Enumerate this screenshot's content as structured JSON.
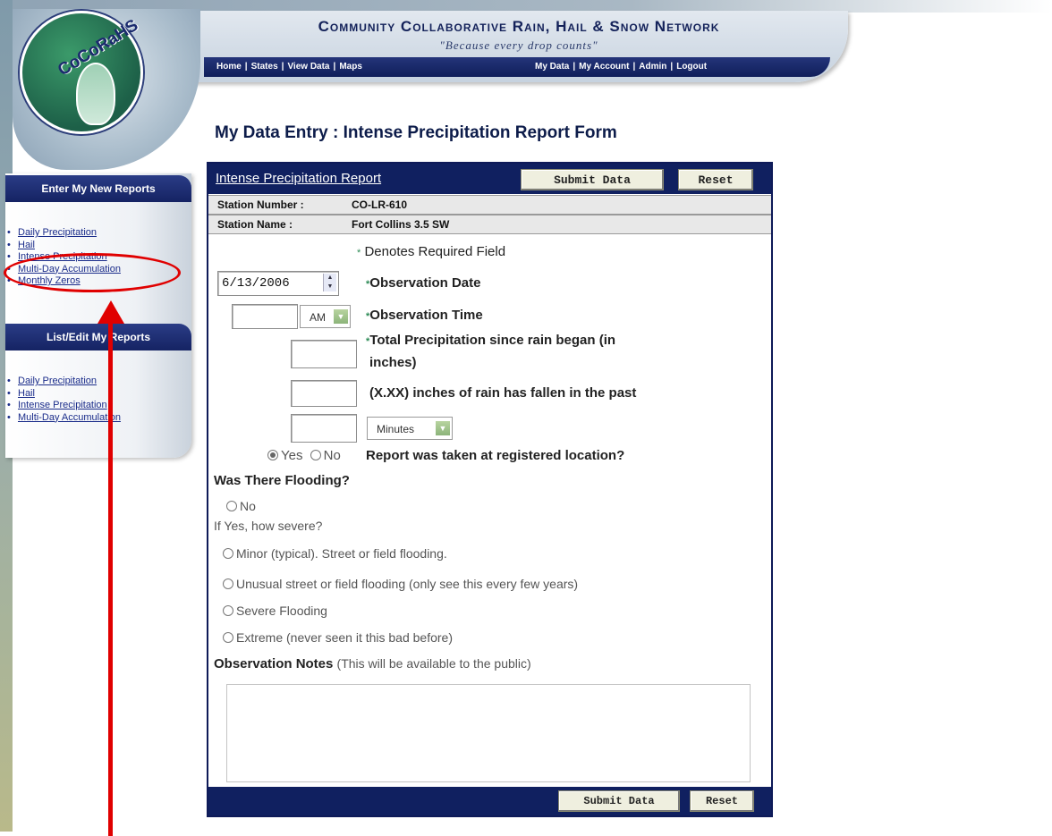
{
  "header": {
    "logo_text": "CoCoRaHS",
    "site_title": "Community Collaborative Rain, Hail & Snow Network",
    "tagline": "\"Because every drop counts\"",
    "nav_left": [
      "Home",
      "States",
      "View Data",
      "Maps"
    ],
    "nav_right": [
      "My Data",
      "My Account",
      "Admin",
      "Logout"
    ]
  },
  "page_heading": "My Data Entry : Intense Precipitation Report Form",
  "sidebar": {
    "enter_title": "Enter My New Reports",
    "enter_items": [
      "Daily Precipitation",
      "Hail",
      "Intense Precipitation",
      "Multi-Day Accumulation",
      "Monthly Zeros"
    ],
    "list_title": "List/Edit My Reports",
    "list_items": [
      "Daily Precipitation",
      "Hail",
      "Intense Precipitation",
      "Multi-Day Accumulation"
    ]
  },
  "form": {
    "title": "Intense Precipitation Report",
    "submit_label": "Submit Data",
    "reset_label": "Reset",
    "station_number_label": "Station Number :",
    "station_number": "CO-LR-610",
    "station_name_label": "Station Name :",
    "station_name": "Fort Collins 3.5 SW",
    "required_note": "Denotes Required Field",
    "observation_date_value": "6/13/2006",
    "observation_date_label": "Observation Date",
    "observation_time_value": "",
    "ampm_value": "AM",
    "observation_time_label": "Observation Time",
    "total_precip_value": "",
    "total_precip_label_1": "Total Precipitation since rain began (in",
    "total_precip_label_2": "inches)",
    "rain_past_value": "",
    "rain_past_label": "(X.XX) inches of rain has fallen in the past",
    "duration_value": "",
    "duration_unit": "Minutes",
    "location_yes": "Yes",
    "location_no": "No",
    "location_question": "Report was taken at registered location?",
    "flooding_title": "Was There Flooding?",
    "flood_no": "No",
    "flood_severity_prompt": "If Yes, how severe?",
    "flood_options": [
      "Minor (typical). Street or field flooding.",
      "Unusual street or field flooding (only see this every few years)",
      "Severe Flooding",
      "Extreme (never seen it this bad before)"
    ],
    "notes_label": "Observation Notes",
    "notes_hint": "(This will be available to the public)",
    "notes_value": ""
  },
  "colors": {
    "navy": "#102060",
    "annotation_red": "#e00000",
    "required_green": "#2c8a55"
  }
}
